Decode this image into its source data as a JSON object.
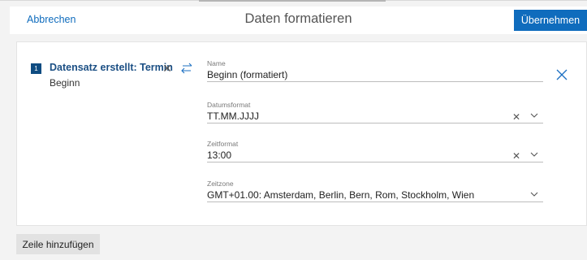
{
  "header": {
    "cancel_label": "Abbrechen",
    "title": "Daten formatieren",
    "apply_label": "Übernehmen"
  },
  "record": {
    "index": "1",
    "title": "Datensatz erstellt: Termin",
    "field": "Beginn",
    "remove_icon": "close-icon",
    "swap_icon": "swap-arrows-icon"
  },
  "fields": {
    "name": {
      "label": "Name",
      "value": "Beginn (formatiert)"
    },
    "date_format": {
      "label": "Datumsformat",
      "value": "TT.MM.JJJJ"
    },
    "time_format": {
      "label": "Zeitformat",
      "value": "13:00"
    },
    "timezone": {
      "label": "Zeitzone",
      "value": "GMT+01.00: Amsterdam, Berlin, Bern, Rom, Stockholm, Wien"
    }
  },
  "footer": {
    "add_row_label": "Zeile hinzufügen"
  },
  "colors": {
    "accent": "#0f6cbd",
    "badge": "#0f4c81",
    "background": "#f3f3f3"
  }
}
